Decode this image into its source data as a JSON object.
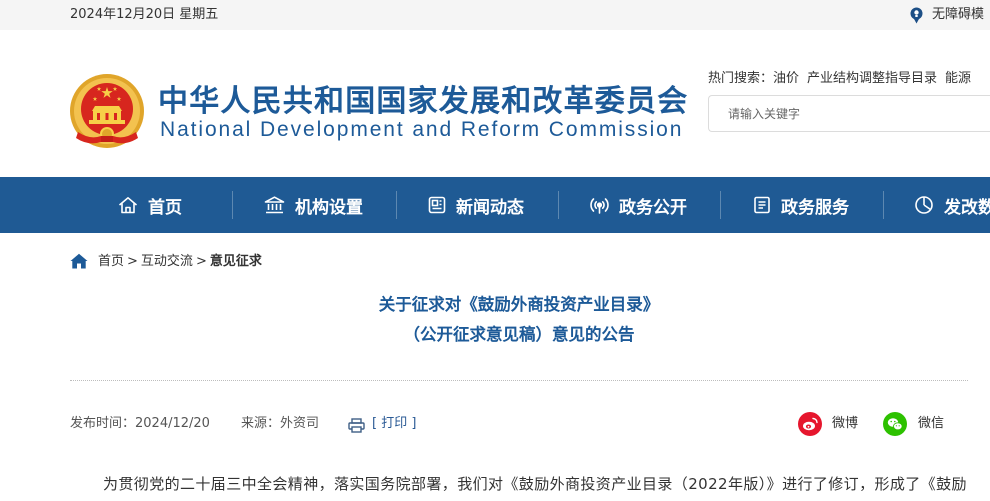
{
  "topbar": {
    "date": "2024年12月20日 星期五",
    "accessibility": "无障碍模"
  },
  "header": {
    "logo_icon": "national-emblem-icon",
    "title_cn": "中华人民共和国国家发展和改革委员会",
    "title_en": "National Development and Reform Commission",
    "hot_search_label": "热门搜索：",
    "hot_search_items": [
      "油价",
      "产业结构调整指导目录",
      "能源"
    ],
    "search_placeholder": "请输入关键字"
  },
  "nav": {
    "items": [
      {
        "label": "首页",
        "icon": "home-icon"
      },
      {
        "label": "机构设置",
        "icon": "building-icon"
      },
      {
        "label": "新闻动态",
        "icon": "newspaper-icon"
      },
      {
        "label": "政务公开",
        "icon": "broadcast-icon"
      },
      {
        "label": "政务服务",
        "icon": "document-icon"
      },
      {
        "label": "发改数",
        "icon": "pie-chart-icon"
      }
    ]
  },
  "breadcrumb": {
    "items": [
      "首页",
      "互动交流",
      "意见征求"
    ],
    "separator": ">"
  },
  "article": {
    "title_line1": "关于征求对《鼓励外商投资产业目录》",
    "title_line2": "（公开征求意见稿）意见的公告",
    "publish": "发布时间：2024/12/20",
    "source": "来源：外资司",
    "print": "[ 打印 ]",
    "share": {
      "weibo": "微博",
      "wechat": "微信"
    },
    "body_first_line": "为贯彻党的二十届三中全会精神，落实国务院部署，我们对《鼓励外商投资产业目录（2022年版）》进行了修订，形成了《鼓励"
  },
  "colors": {
    "brand_blue": "#1d5a98",
    "nav_background": "#1f5a94",
    "topbar_background": "#f5f5f5",
    "weibo_red": "#e6162d",
    "wechat_green": "#2dc100"
  }
}
